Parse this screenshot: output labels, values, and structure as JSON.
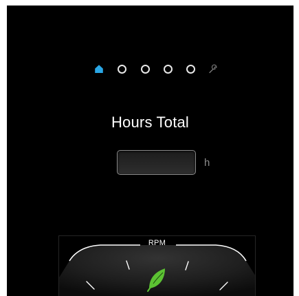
{
  "pager": {
    "pages": [
      {
        "icon": "home-icon",
        "active": true
      },
      {
        "icon": "page-dot-icon",
        "active": false
      },
      {
        "icon": "page-dot-icon",
        "active": false
      },
      {
        "icon": "page-dot-icon",
        "active": false
      },
      {
        "icon": "page-dot-icon",
        "active": false
      },
      {
        "icon": "wrench-icon",
        "active": false
      }
    ]
  },
  "colors": {
    "accent": "#2aa7e6",
    "leaf": "#5cc233",
    "background": "#000000",
    "text": "#ffffff",
    "muted": "#8c8c8c"
  },
  "main": {
    "title": "Hours Total",
    "hours_value": "",
    "unit": "h"
  },
  "gauge": {
    "label": "RPM",
    "eco_icon": "leaf-icon"
  }
}
